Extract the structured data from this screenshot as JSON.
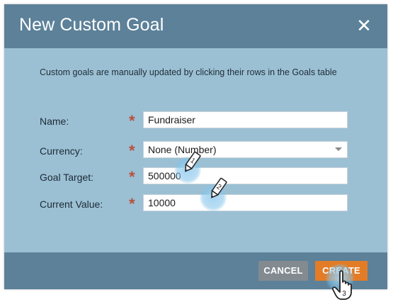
{
  "dialog": {
    "title": "New Custom Goal",
    "close_glyph": "✕",
    "description": "Custom goals are manually updated by clicking their rows in the Goals table"
  },
  "form": {
    "required_marker": "*",
    "name": {
      "label": "Name:",
      "value": "Fundraiser"
    },
    "currency": {
      "label": "Currency:",
      "value": "None (Number)"
    },
    "goal_target": {
      "label": "Goal Target:",
      "value": "500000"
    },
    "current_value": {
      "label": "Current Value:",
      "value": "10000"
    }
  },
  "footer": {
    "cancel_label": "CANCEL",
    "create_label": "CREATE"
  },
  "annotations": {
    "step1": "1",
    "step2": "2",
    "step3": "3"
  },
  "colors": {
    "header": "#5c8199",
    "body": "#9bc0d4",
    "create": "#e37c27",
    "cancel": "#838b91",
    "required": "#b8513c"
  },
  "icons": [
    "close-icon",
    "chevron-down-icon",
    "pencil-icon",
    "hand-pointer-icon"
  ]
}
